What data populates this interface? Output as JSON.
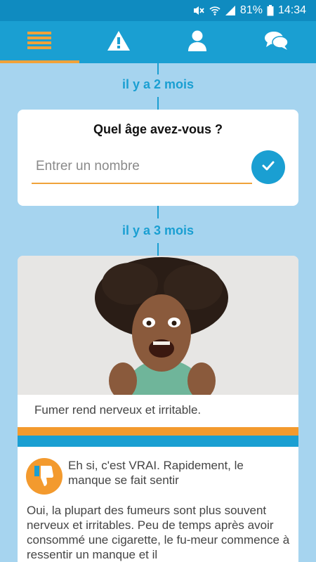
{
  "status_bar": {
    "battery_percent": "81%",
    "time": "14:34",
    "icons": [
      "mute-icon",
      "wifi-icon",
      "signal-icon",
      "battery-icon"
    ]
  },
  "nav": {
    "tabs": [
      {
        "name": "feed",
        "icon": "list-icon",
        "active": true
      },
      {
        "name": "warning",
        "icon": "warning-icon",
        "active": false
      },
      {
        "name": "profile",
        "icon": "user-icon",
        "active": false
      },
      {
        "name": "chat",
        "icon": "chat-icon",
        "active": false
      }
    ]
  },
  "timeline": {
    "entries": [
      {
        "label": "il y a 2 mois"
      },
      {
        "label": "il y a 3 mois"
      }
    ]
  },
  "question_card": {
    "title": "Quel âge avez-vous ?",
    "placeholder": "Entrer un nombre",
    "value": ""
  },
  "statement_card": {
    "caption": "Fumer rend nerveux et irritable."
  },
  "answer_card": {
    "verdict_icon": "thumbs-down-icon",
    "verdict": "Eh si, c'est VRAI. Rapidement, le manque se fait sentir",
    "body": "Oui, la plupart des fumeurs sont plus souvent nerveux et irritables. Peu de temps après avoir consommé une cigarette, le fu-meur commence à ressentir un manque et il"
  },
  "colors": {
    "primary": "#1a9fd2",
    "accent": "#f0a23a",
    "background": "#a6d4ef"
  }
}
